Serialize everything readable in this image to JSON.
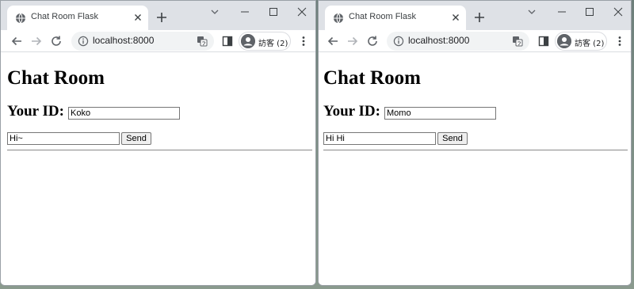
{
  "windows": [
    {
      "tab": {
        "title": "Chat Room Flask"
      },
      "omnibox": {
        "url": "localhost:8000"
      },
      "profile": {
        "label": "訪客 (2)"
      },
      "page": {
        "heading": "Chat Room",
        "id_label": "Your ID:",
        "id_value": "Koko",
        "message_value": "Hi~",
        "send_label": "Send"
      }
    },
    {
      "tab": {
        "title": "Chat Room Flask"
      },
      "omnibox": {
        "url": "localhost:8000"
      },
      "profile": {
        "label": "訪客 (2)"
      },
      "page": {
        "heading": "Chat Room",
        "id_label": "Your ID:",
        "id_value": "Momo",
        "message_value": "Hi Hi",
        "send_label": "Send"
      }
    }
  ],
  "colors": {
    "tabstrip": "#dee1e6",
    "omnibox": "#f1f3f4",
    "icon": "#5f6368",
    "desktop": "#7d8e86"
  },
  "icons": [
    "globe-icon",
    "close-icon",
    "plus-icon",
    "chevron-down-icon",
    "minimize-icon",
    "maximize-icon",
    "back-icon",
    "forward-icon",
    "reload-icon",
    "info-icon",
    "translate-icon",
    "side-panel-icon",
    "profile-icon",
    "more-icon"
  ]
}
